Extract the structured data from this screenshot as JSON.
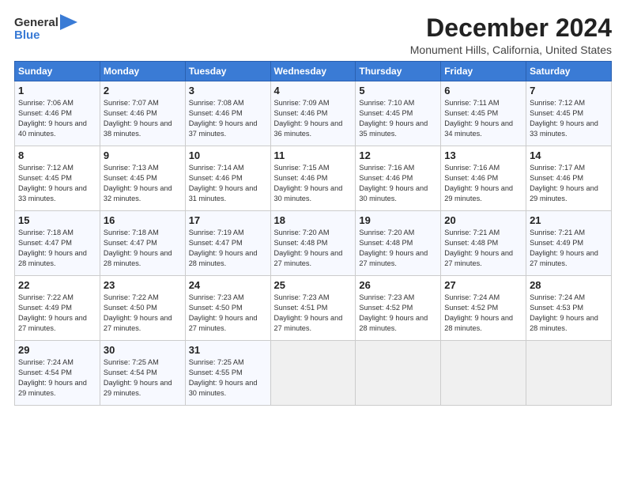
{
  "logo": {
    "general": "General",
    "blue": "Blue",
    "icon": "▶"
  },
  "title": "December 2024",
  "location": "Monument Hills, California, United States",
  "days_header": [
    "Sunday",
    "Monday",
    "Tuesday",
    "Wednesday",
    "Thursday",
    "Friday",
    "Saturday"
  ],
  "weeks": [
    [
      {
        "day": "1",
        "sunrise": "Sunrise: 7:06 AM",
        "sunset": "Sunset: 4:46 PM",
        "daylight": "Daylight: 9 hours and 40 minutes."
      },
      {
        "day": "2",
        "sunrise": "Sunrise: 7:07 AM",
        "sunset": "Sunset: 4:46 PM",
        "daylight": "Daylight: 9 hours and 38 minutes."
      },
      {
        "day": "3",
        "sunrise": "Sunrise: 7:08 AM",
        "sunset": "Sunset: 4:46 PM",
        "daylight": "Daylight: 9 hours and 37 minutes."
      },
      {
        "day": "4",
        "sunrise": "Sunrise: 7:09 AM",
        "sunset": "Sunset: 4:46 PM",
        "daylight": "Daylight: 9 hours and 36 minutes."
      },
      {
        "day": "5",
        "sunrise": "Sunrise: 7:10 AM",
        "sunset": "Sunset: 4:45 PM",
        "daylight": "Daylight: 9 hours and 35 minutes."
      },
      {
        "day": "6",
        "sunrise": "Sunrise: 7:11 AM",
        "sunset": "Sunset: 4:45 PM",
        "daylight": "Daylight: 9 hours and 34 minutes."
      },
      {
        "day": "7",
        "sunrise": "Sunrise: 7:12 AM",
        "sunset": "Sunset: 4:45 PM",
        "daylight": "Daylight: 9 hours and 33 minutes."
      }
    ],
    [
      {
        "day": "8",
        "sunrise": "Sunrise: 7:12 AM",
        "sunset": "Sunset: 4:45 PM",
        "daylight": "Daylight: 9 hours and 33 minutes."
      },
      {
        "day": "9",
        "sunrise": "Sunrise: 7:13 AM",
        "sunset": "Sunset: 4:45 PM",
        "daylight": "Daylight: 9 hours and 32 minutes."
      },
      {
        "day": "10",
        "sunrise": "Sunrise: 7:14 AM",
        "sunset": "Sunset: 4:46 PM",
        "daylight": "Daylight: 9 hours and 31 minutes."
      },
      {
        "day": "11",
        "sunrise": "Sunrise: 7:15 AM",
        "sunset": "Sunset: 4:46 PM",
        "daylight": "Daylight: 9 hours and 30 minutes."
      },
      {
        "day": "12",
        "sunrise": "Sunrise: 7:16 AM",
        "sunset": "Sunset: 4:46 PM",
        "daylight": "Daylight: 9 hours and 30 minutes."
      },
      {
        "day": "13",
        "sunrise": "Sunrise: 7:16 AM",
        "sunset": "Sunset: 4:46 PM",
        "daylight": "Daylight: 9 hours and 29 minutes."
      },
      {
        "day": "14",
        "sunrise": "Sunrise: 7:17 AM",
        "sunset": "Sunset: 4:46 PM",
        "daylight": "Daylight: 9 hours and 29 minutes."
      }
    ],
    [
      {
        "day": "15",
        "sunrise": "Sunrise: 7:18 AM",
        "sunset": "Sunset: 4:47 PM",
        "daylight": "Daylight: 9 hours and 28 minutes."
      },
      {
        "day": "16",
        "sunrise": "Sunrise: 7:18 AM",
        "sunset": "Sunset: 4:47 PM",
        "daylight": "Daylight: 9 hours and 28 minutes."
      },
      {
        "day": "17",
        "sunrise": "Sunrise: 7:19 AM",
        "sunset": "Sunset: 4:47 PM",
        "daylight": "Daylight: 9 hours and 28 minutes."
      },
      {
        "day": "18",
        "sunrise": "Sunrise: 7:20 AM",
        "sunset": "Sunset: 4:48 PM",
        "daylight": "Daylight: 9 hours and 27 minutes."
      },
      {
        "day": "19",
        "sunrise": "Sunrise: 7:20 AM",
        "sunset": "Sunset: 4:48 PM",
        "daylight": "Daylight: 9 hours and 27 minutes."
      },
      {
        "day": "20",
        "sunrise": "Sunrise: 7:21 AM",
        "sunset": "Sunset: 4:48 PM",
        "daylight": "Daylight: 9 hours and 27 minutes."
      },
      {
        "day": "21",
        "sunrise": "Sunrise: 7:21 AM",
        "sunset": "Sunset: 4:49 PM",
        "daylight": "Daylight: 9 hours and 27 minutes."
      }
    ],
    [
      {
        "day": "22",
        "sunrise": "Sunrise: 7:22 AM",
        "sunset": "Sunset: 4:49 PM",
        "daylight": "Daylight: 9 hours and 27 minutes."
      },
      {
        "day": "23",
        "sunrise": "Sunrise: 7:22 AM",
        "sunset": "Sunset: 4:50 PM",
        "daylight": "Daylight: 9 hours and 27 minutes."
      },
      {
        "day": "24",
        "sunrise": "Sunrise: 7:23 AM",
        "sunset": "Sunset: 4:50 PM",
        "daylight": "Daylight: 9 hours and 27 minutes."
      },
      {
        "day": "25",
        "sunrise": "Sunrise: 7:23 AM",
        "sunset": "Sunset: 4:51 PM",
        "daylight": "Daylight: 9 hours and 27 minutes."
      },
      {
        "day": "26",
        "sunrise": "Sunrise: 7:23 AM",
        "sunset": "Sunset: 4:52 PM",
        "daylight": "Daylight: 9 hours and 28 minutes."
      },
      {
        "day": "27",
        "sunrise": "Sunrise: 7:24 AM",
        "sunset": "Sunset: 4:52 PM",
        "daylight": "Daylight: 9 hours and 28 minutes."
      },
      {
        "day": "28",
        "sunrise": "Sunrise: 7:24 AM",
        "sunset": "Sunset: 4:53 PM",
        "daylight": "Daylight: 9 hours and 28 minutes."
      }
    ],
    [
      {
        "day": "29",
        "sunrise": "Sunrise: 7:24 AM",
        "sunset": "Sunset: 4:54 PM",
        "daylight": "Daylight: 9 hours and 29 minutes."
      },
      {
        "day": "30",
        "sunrise": "Sunrise: 7:25 AM",
        "sunset": "Sunset: 4:54 PM",
        "daylight": "Daylight: 9 hours and 29 minutes."
      },
      {
        "day": "31",
        "sunrise": "Sunrise: 7:25 AM",
        "sunset": "Sunset: 4:55 PM",
        "daylight": "Daylight: 9 hours and 30 minutes."
      },
      null,
      null,
      null,
      null
    ]
  ]
}
